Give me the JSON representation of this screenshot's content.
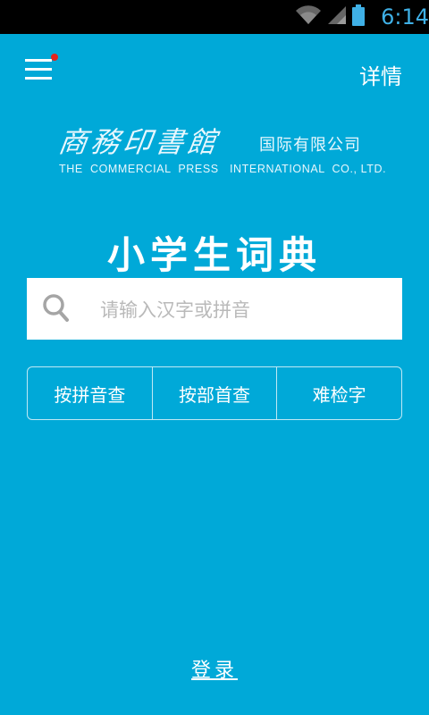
{
  "status_bar": {
    "time": "6:14",
    "icons": [
      "wifi-icon",
      "cell-signal-icon",
      "battery-icon"
    ],
    "time_color": "#3fb0e6"
  },
  "header": {
    "menu_icon": "menu-icon",
    "has_notification_dot": true,
    "detail_label": "详情"
  },
  "logo": {
    "calligraphy": "商務印書館",
    "chinese_subtitle": "国际有限公司",
    "english": "THE  COMMERCIAL  PRESS   INTERNATIONAL  CO., LTD."
  },
  "app_title": "小学生词典",
  "search": {
    "icon": "search-icon",
    "placeholder": "请输入汉字或拼音",
    "value": ""
  },
  "lookup_buttons": [
    {
      "label": "按拼音查"
    },
    {
      "label": "按部首查"
    },
    {
      "label": "难检字"
    }
  ],
  "login_label": "登录",
  "colors": {
    "background": "#00a9d8",
    "notification_dot": "#e3231c",
    "status_bar": "#000000"
  }
}
